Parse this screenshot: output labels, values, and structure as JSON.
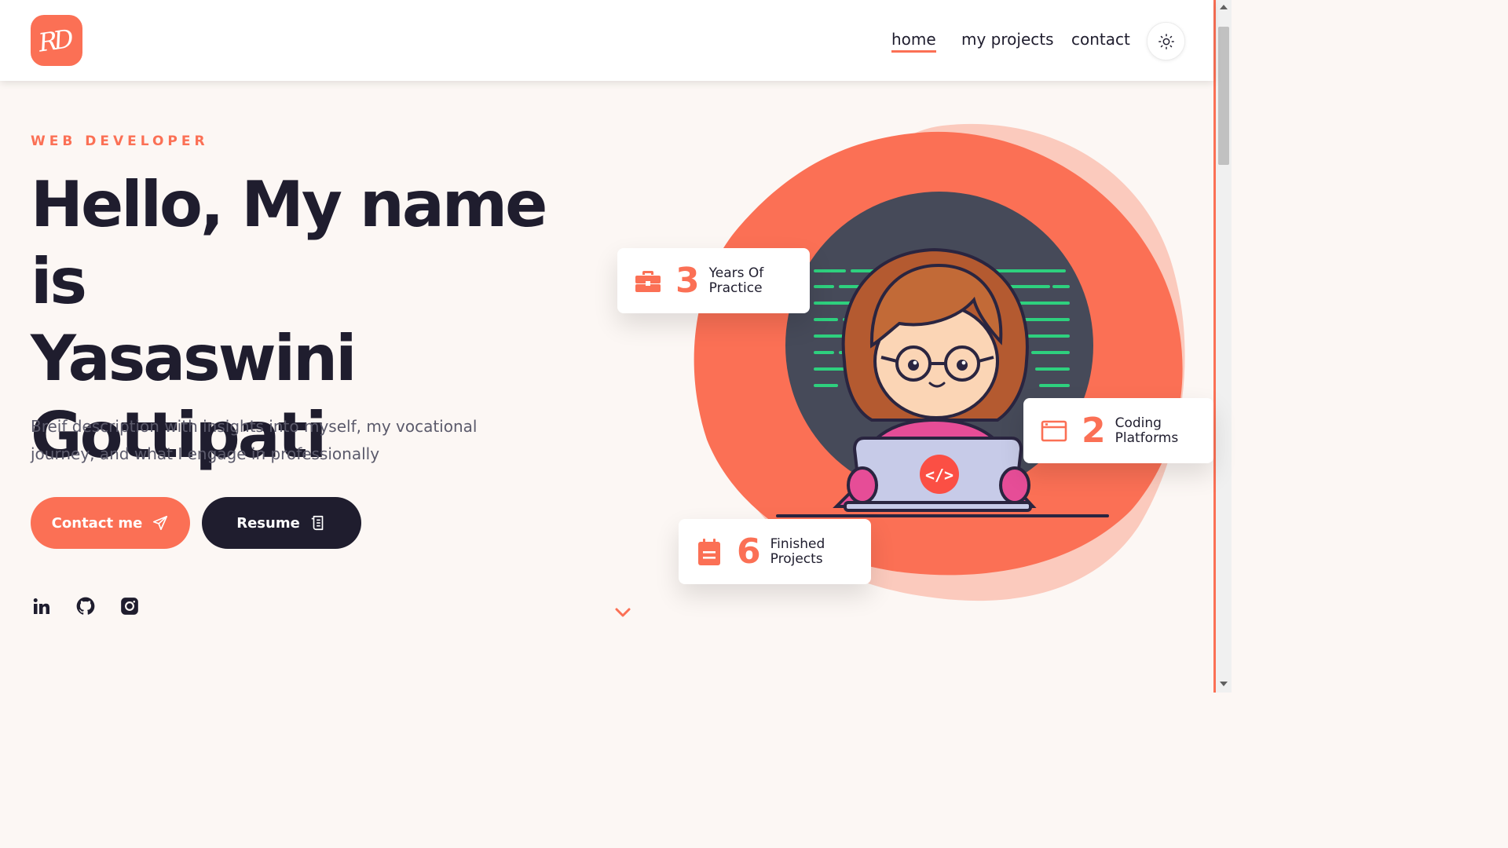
{
  "header": {
    "logo_text": "RD",
    "nav": [
      {
        "label": "home",
        "active": true
      },
      {
        "label": "my projects",
        "active": false
      },
      {
        "label": "contact",
        "active": false
      }
    ],
    "theme_icon": "sun-icon"
  },
  "hero": {
    "role": "WEB DEVELOPER",
    "headline": [
      "Hello, My name is",
      "Yasaswini",
      "Gottipati"
    ],
    "description": "Breif description with insights into myself, my vocational journey, and what I engage in professionally",
    "buttons": {
      "contact_label": "Contact me",
      "contact_icon": "paper-plane-icon",
      "resume_label": "Resume",
      "resume_icon": "document-icon"
    },
    "social": [
      "linkedin-icon",
      "github-icon",
      "instagram-icon"
    ]
  },
  "stats": [
    {
      "number": "3",
      "label": "Years Of Practice",
      "icon": "briefcase-icon"
    },
    {
      "number": "2",
      "label": "Coding Platforms",
      "icon": "browser-window-icon"
    },
    {
      "number": "6",
      "label": "Finished Projects",
      "icon": "clipboard-icon"
    }
  ],
  "colors": {
    "accent": "#fb7055",
    "dark": "#1f1d2e",
    "background": "#fcf7f4",
    "blob_light": "#fbcabd",
    "code_green": "#2ed07e"
  }
}
